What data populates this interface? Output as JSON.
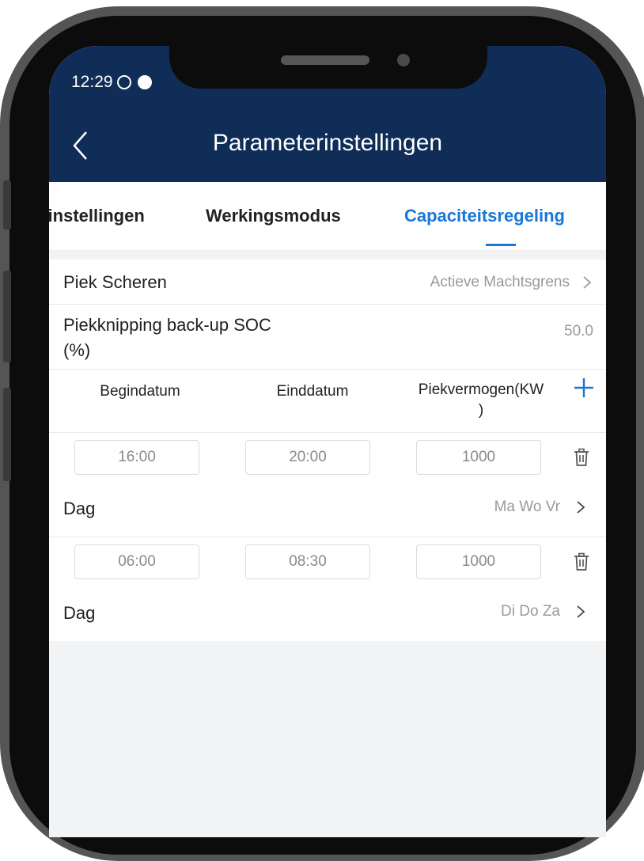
{
  "status_bar": {
    "time": "12:29"
  },
  "header": {
    "title": "Parameterinstellingen"
  },
  "tabs": [
    {
      "label": "Parameterinstellingen",
      "visible_label": "rinstellingen"
    },
    {
      "label": "Werkingsmodus"
    },
    {
      "label": "Capaciteitsregeling",
      "active": true
    }
  ],
  "settings": {
    "peak_shaving_label": "Piek Scheren",
    "peak_shaving_value": "Actieve Machtsgrens",
    "backup_soc_label_line1": "Piekknipping back-up SOC",
    "backup_soc_label_line2": "(%)",
    "backup_soc_value": "50.0"
  },
  "table": {
    "col_start": "Begindatum",
    "col_end": "Einddatum",
    "col_power_line1": "Piekvermogen(KW",
    "col_power_line2": ")",
    "rows": [
      {
        "start": "16:00",
        "end": "20:00",
        "power": "1000",
        "day_label": "Dag",
        "days": "Ma Wo Vr"
      },
      {
        "start": "06:00",
        "end": "08:30",
        "power": "1000",
        "day_label": "Dag",
        "days": "Di Do Za"
      }
    ]
  },
  "colors": {
    "header_bg": "#0f2d57",
    "accent": "#1b77d6",
    "background": "#f2f3f5"
  }
}
